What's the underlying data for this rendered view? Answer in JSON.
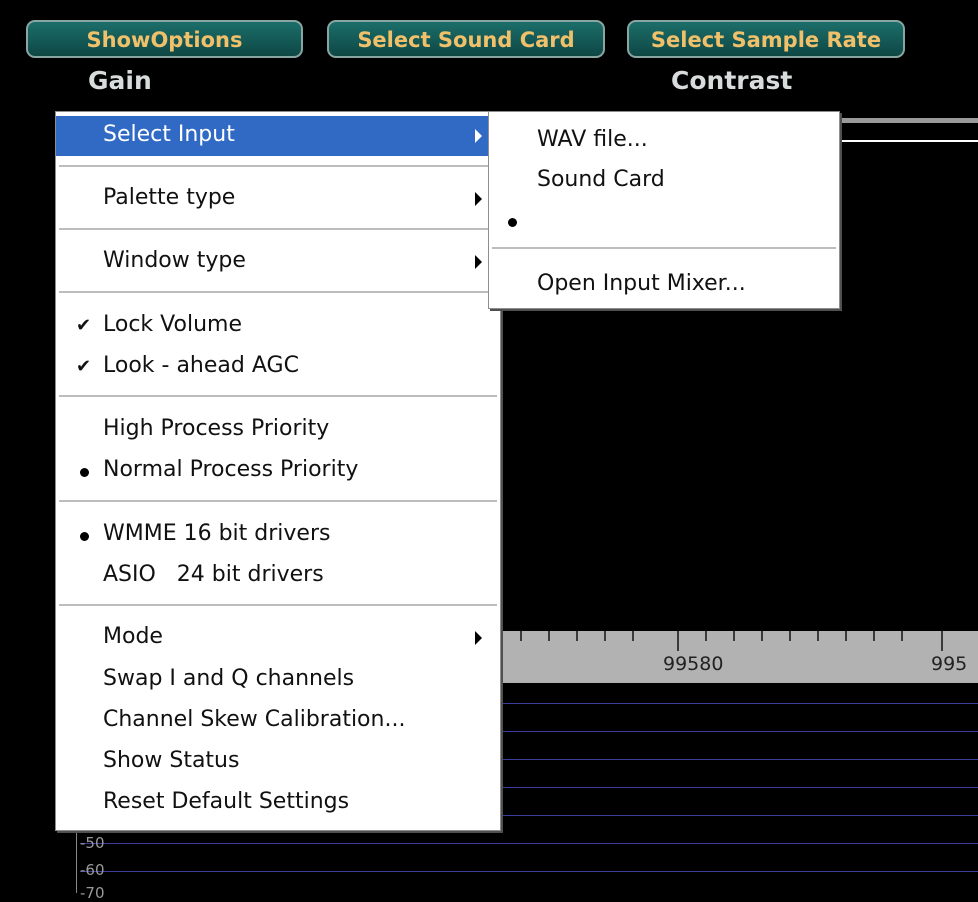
{
  "toolbar": {
    "show_options": "ShowOptions",
    "select_sound_card": "Select Sound Card",
    "select_sample_rate": "Select Sample Rate"
  },
  "labels": {
    "gain": "Gain",
    "contrast": "Contrast"
  },
  "ruler": {
    "ticks": [
      "99580",
      "995"
    ]
  },
  "y_axis": [
    "-50",
    "-60",
    "-70"
  ],
  "context_menu": {
    "select_input": "Select Input",
    "palette_type": "Palette type",
    "window_type": "Window type",
    "lock_volume": "Lock Volume",
    "look_ahead_agc": "Look - ahead AGC",
    "high_priority": "High Process Priority",
    "normal_priority": "Normal Process Priority",
    "wmme": "WMME 16 bit drivers",
    "asio": "ASIO   24 bit drivers",
    "mode": "Mode",
    "swap_iq": "Swap I and Q channels",
    "skew": "Channel Skew Calibration...",
    "show_status": "Show Status",
    "reset": "Reset Default Settings"
  },
  "submenu": {
    "wav_file": "WAV file...",
    "sound_card": "Sound Card",
    "open_mixer": "Open Input Mixer..."
  },
  "colors": {
    "background": "#000000",
    "button_face": "#1c6e6a",
    "button_text": "#f0c06a",
    "menu_highlight": "#316ac5",
    "ruler": "#b2b2b2",
    "grid_line": "#3c3c9a"
  },
  "icons": {
    "checked": "check-icon",
    "radio": "radio-dot-icon",
    "submenu": "submenu-arrow-icon"
  }
}
